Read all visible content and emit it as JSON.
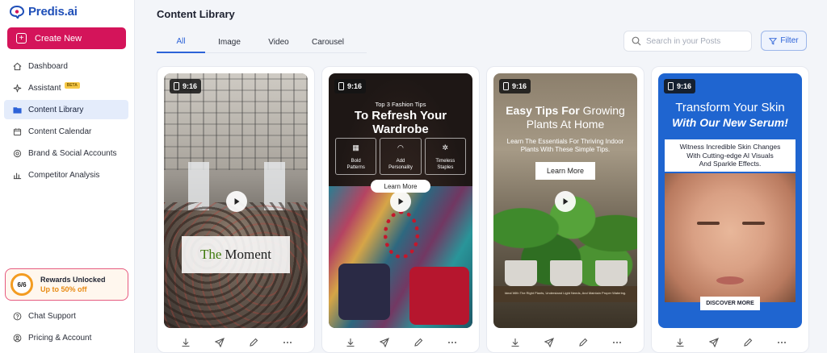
{
  "app": {
    "name": "Predis.ai"
  },
  "sidebar": {
    "create_label": "Create New",
    "items": [
      {
        "label": "Dashboard",
        "icon": "home-icon",
        "active": false
      },
      {
        "label": "Assistant",
        "icon": "sparkle-icon",
        "badge": "BETA",
        "active": false
      },
      {
        "label": "Content Library",
        "icon": "folder-icon",
        "active": true
      },
      {
        "label": "Content Calendar",
        "icon": "calendar-icon",
        "active": false
      },
      {
        "label": "Brand & Social Accounts",
        "icon": "at-icon",
        "active": false
      },
      {
        "label": "Competitor Analysis",
        "icon": "bar-chart-icon",
        "active": false
      }
    ],
    "rewards": {
      "progress": "6/6",
      "title": "Rewards Unlocked",
      "subtitle": "Up to 50% off"
    },
    "bottom_items": [
      {
        "label": "Chat Support",
        "icon": "help-icon"
      },
      {
        "label": "Pricing & Account",
        "icon": "user-icon"
      }
    ]
  },
  "main": {
    "title": "Content Library",
    "tabs": [
      {
        "label": "All",
        "active": true
      },
      {
        "label": "Image",
        "active": false
      },
      {
        "label": "Video",
        "active": false
      },
      {
        "label": "Carousel",
        "active": false
      }
    ],
    "search_placeholder": "Search in your Posts",
    "filter_label": "Filter",
    "cards": [
      {
        "ratio": "9:16",
        "overlay_highlight": "The",
        "overlay_text": "Moment"
      },
      {
        "ratio": "9:16",
        "small_title": "Top 3 Fashion Tips",
        "title_line1": "To Refresh Your",
        "title_line2": "Wardrobe",
        "features": [
          {
            "line1": "Bold",
            "line2": "Patterns",
            "icon": "grid-icon"
          },
          {
            "line1": "Add",
            "line2": "Personality",
            "icon": "wifi-icon"
          },
          {
            "line1": "Timeless",
            "line2": "Staples",
            "icon": "star-icon"
          }
        ],
        "cta": "Learn More"
      },
      {
        "ratio": "9:16",
        "title_bold": "Easy Tips For",
        "title_rest": "Growing",
        "title_line2": "Plants At Home",
        "body_line1": "Learn The Essentials For Thriving Indoor",
        "body_line2": "Plants With These Simple Tips.",
        "cta": "Learn More",
        "fine_print": "Ideal With The Right Plants, Understand Light Needs, And Maintain Proper Watering."
      },
      {
        "ratio": "9:16",
        "title_line1": "Transform Your Skin",
        "title_line2": "With Our New Serum!",
        "body_line1": "Witness Incredible Skin Changes",
        "body_line2": "With Cutting-edge AI Visuals",
        "body_line3": "And Sparkle Effects.",
        "cta": "DISCOVER MORE"
      }
    ]
  },
  "colors": {
    "brand_blue": "#1f4fb8",
    "create_pink": "#d4145a",
    "accent_blue": "#2d63d8",
    "rewards_orange": "#f39c21"
  }
}
